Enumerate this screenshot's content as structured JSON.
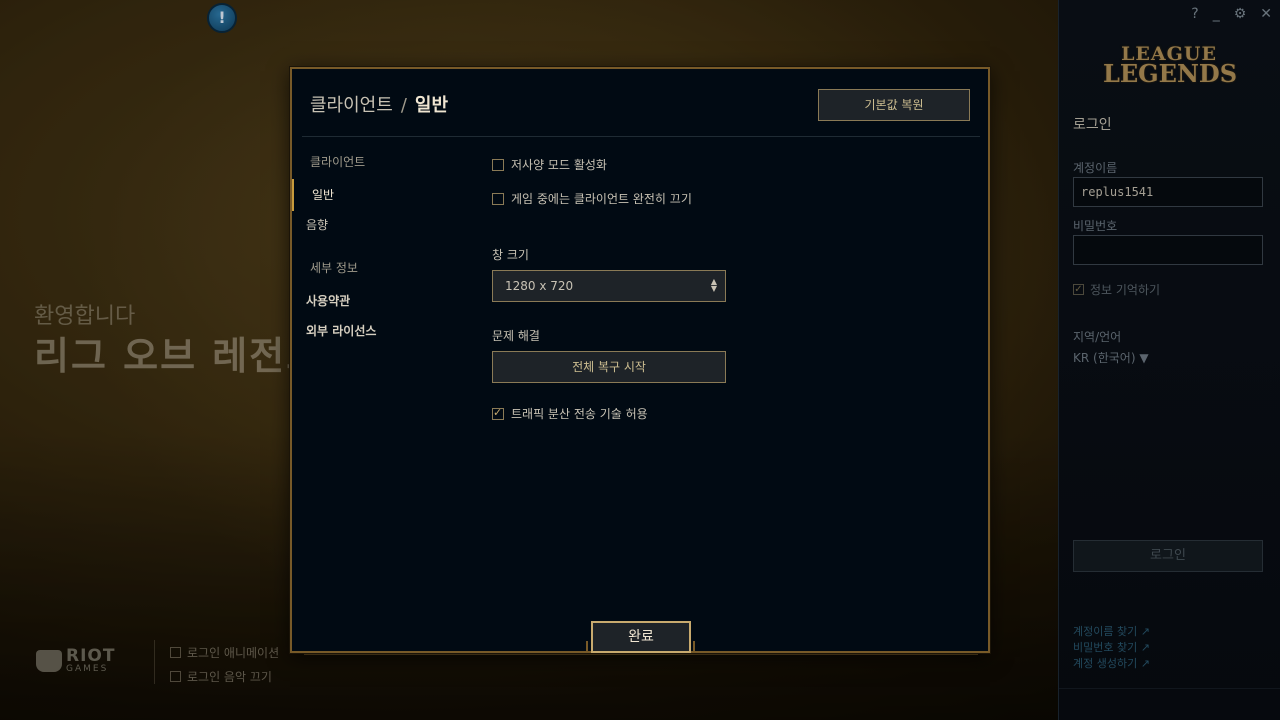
{
  "background": {
    "welcome_small": "환영합니다",
    "welcome_big": "리그 오브 레전드",
    "riot_logo": {
      "line1": "RIOT",
      "line2": "GAMES"
    },
    "options": [
      {
        "label": "로그인 애니메이션",
        "checked": false
      },
      {
        "label": "로그인 음악 끄기",
        "checked": false
      }
    ],
    "alert_icon_glyph": "!"
  },
  "login_panel": {
    "window_controls": {
      "help": "?",
      "minimize": "_",
      "settings": "⚙",
      "close": "✕"
    },
    "logo": {
      "line1": "LEAGUE",
      "line2": "LEGENDS"
    },
    "title": "로그인",
    "username_label": "계정이름",
    "username_value": "replus1541",
    "password_label": "비밀번호",
    "password_value": "",
    "remember_label": "정보 기억하기",
    "remember_checked": true,
    "region_label": "지역/언어",
    "region_value": "KR (한국어) ▼",
    "login_button": "로그인",
    "links": [
      "계정이름 찾기 ↗",
      "비밀번호 찾기 ↗",
      "계정 생성하기 ↗"
    ]
  },
  "modal": {
    "breadcrumb_parent": "클라이언트",
    "breadcrumb_sep": "/",
    "breadcrumb_current": "일반",
    "reset_button": "기본값 복원",
    "nav": {
      "section_client": "클라이언트",
      "item_general": "일반",
      "item_sound": "음향",
      "section_details": "세부 정보",
      "link_terms": "사용약관",
      "link_licenses": "외부 라이선스"
    },
    "options": {
      "low_spec": {
        "label": "저사양 모드 활성화",
        "checked": false
      },
      "close_client": {
        "label": "게임 중에는 클라이언트 완전히 끄기",
        "checked": false
      },
      "traffic": {
        "label": "트래픽 분산 전송 기술 허용",
        "checked": true
      }
    },
    "window_size_label": "창 크기",
    "window_size_value": "1280 x 720",
    "troubleshoot_label": "문제 해결",
    "repair_button": "전체 복구 시작",
    "done_button": "완료"
  },
  "colors": {
    "gold_accent": "#c89b3c",
    "modal_border": "#785a28",
    "modal_bg": "#010a13",
    "button_bg": "#1e2328"
  }
}
